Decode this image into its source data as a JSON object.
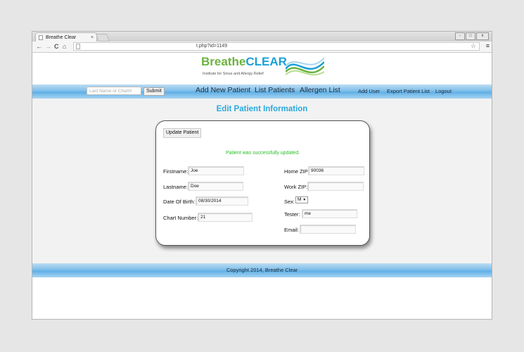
{
  "browser": {
    "tab_title": "Breathe Clear",
    "tab_close": "×",
    "url": "t.php?id=1149",
    "window_controls": [
      "-",
      "□",
      "x"
    ],
    "nav_back": "←",
    "nav_forward": "→",
    "nav_reload": "C",
    "nav_home": "⌂",
    "star": "☆",
    "menu": "≡"
  },
  "logo": {
    "name_part1": "Breathe",
    "name_part2": "CLEAR",
    "tagline": "Institute for Sinus and Allergy Relief",
    "brand_green": "#6cb33f",
    "brand_blue": "#1aa0d8"
  },
  "navbar": {
    "search_placeholder": "Last Name or Chart#",
    "submit_label": "Submit",
    "items_large": [
      "Add New Patient",
      "List Patients",
      "Allergen List"
    ],
    "items_small": [
      "Add User",
      "Export Patient List",
      "Logout"
    ]
  },
  "form": {
    "heading": "Edit Patient Information",
    "update_button": "Update Patient",
    "success_message": "Patient was successfully updated.",
    "firstname_label": "Firstname:",
    "firstname_value": "Joe",
    "lastname_label": "Lastname:",
    "lastname_value": "Doe",
    "dob_label": "Date Of Birth:",
    "dob_value": "08/30/2014",
    "chart_label": "Chart Number:",
    "chart_value": "21",
    "home_zip_label": "Home ZIP:",
    "home_zip_value": "90036",
    "work_zip_label": "Work ZIP:",
    "work_zip_value": "",
    "sex_label": "Sex:",
    "sex_value": "M",
    "tester_label": "Tester:",
    "tester_value": "me",
    "email_label": "Email:",
    "email_value": ""
  },
  "footer": {
    "copyright": "Copyright 2014, Breathe Clear"
  }
}
